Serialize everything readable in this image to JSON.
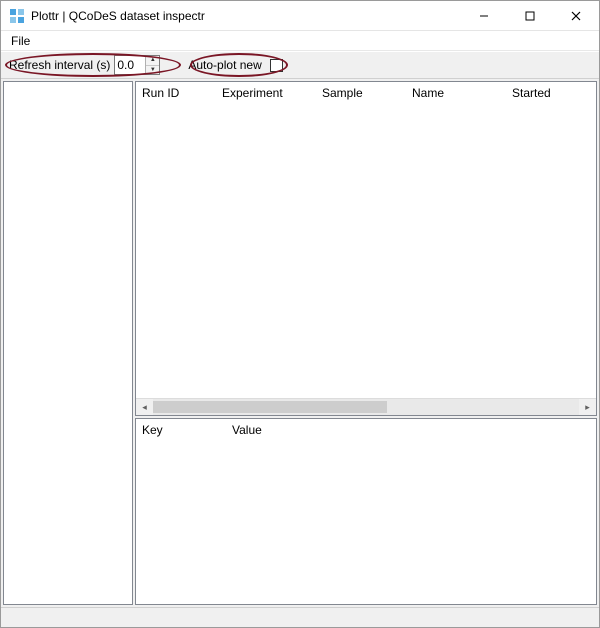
{
  "window": {
    "title": "Plottr | QCoDeS dataset inspectr"
  },
  "menubar": {
    "file": "File"
  },
  "toolbar": {
    "refresh_label": "Refresh interval (s)",
    "refresh_value": "0.0",
    "autoplot_label": "Auto-plot new",
    "autoplot_checked": false
  },
  "runs_table": {
    "columns": [
      "Run ID",
      "Experiment",
      "Sample",
      "Name",
      "Started"
    ],
    "rows": []
  },
  "details_table": {
    "columns": [
      "Key",
      "Value"
    ],
    "rows": []
  }
}
